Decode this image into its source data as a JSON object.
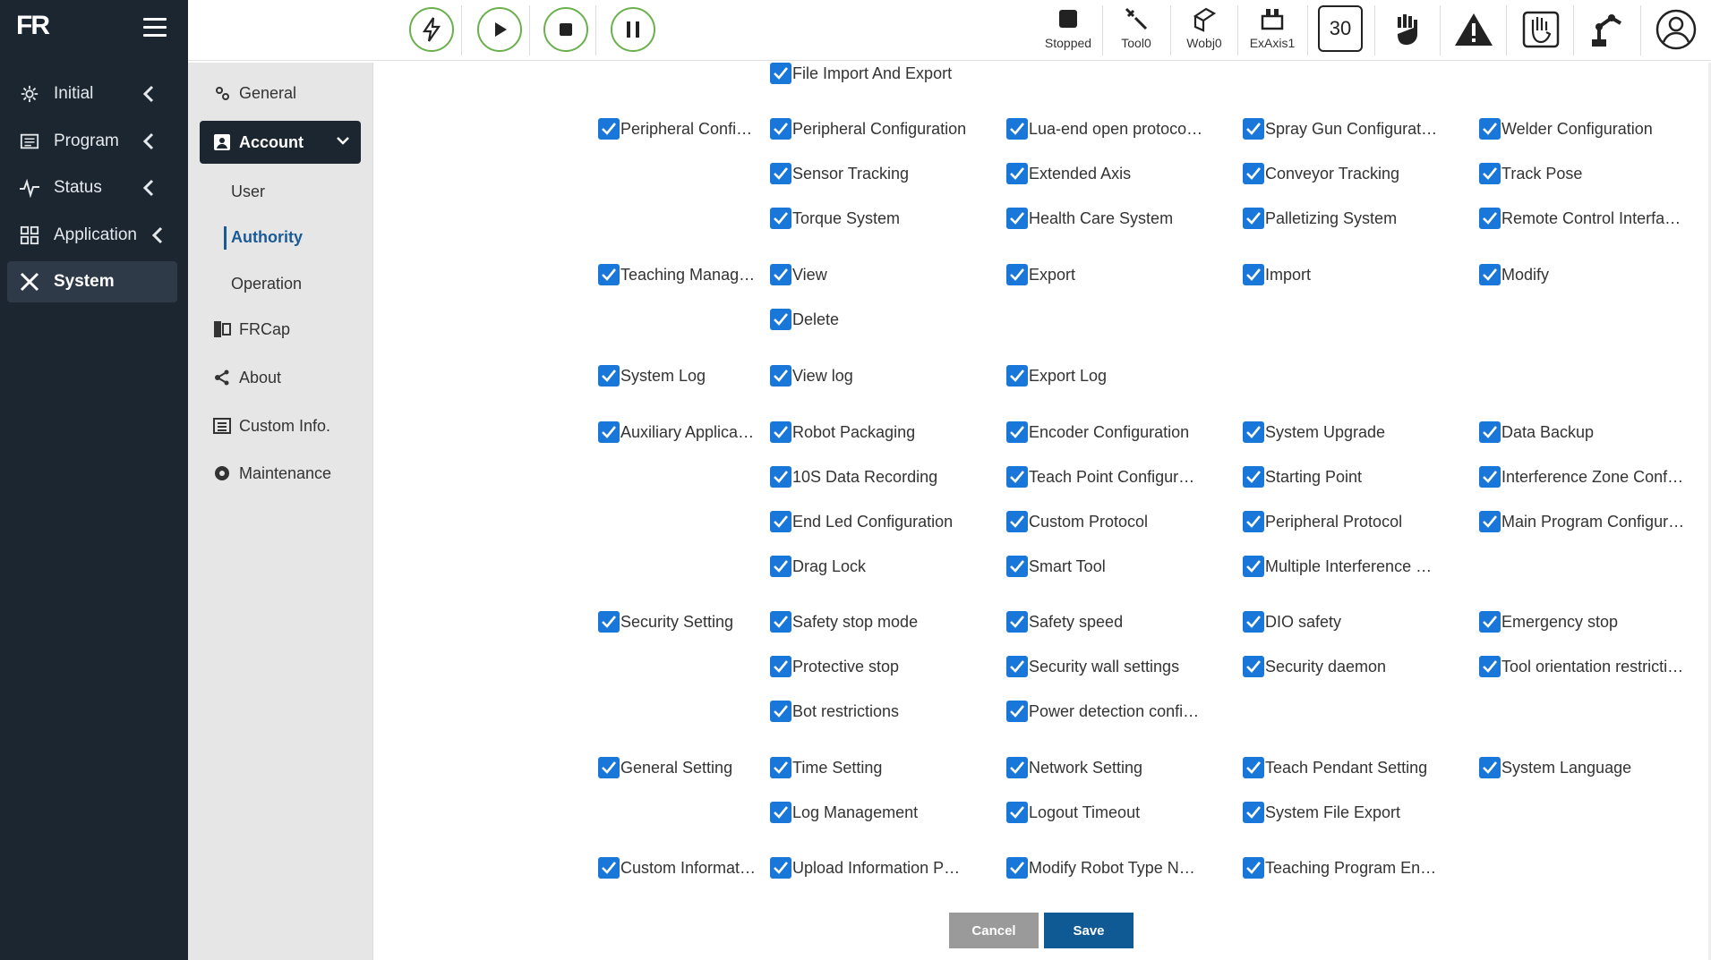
{
  "app": {
    "logo_text": "FR"
  },
  "main_nav": [
    {
      "label": "Initial",
      "icon": "gear-icon"
    },
    {
      "label": "Program",
      "icon": "program-icon"
    },
    {
      "label": "Status",
      "icon": "pulse-icon"
    },
    {
      "label": "Application",
      "icon": "grid-icon"
    },
    {
      "label": "System",
      "icon": "tools-icon",
      "active": true
    }
  ],
  "sub_nav": {
    "general": "General",
    "account": "Account",
    "account_children": [
      "User",
      "Authority",
      "Operation"
    ],
    "active_child": "Authority",
    "frcap": "FRCap",
    "about": "About",
    "custom_info": "Custom Info.",
    "maintenance": "Maintenance"
  },
  "toolbar": {
    "stopped": "Stopped",
    "tool": "Tool0",
    "wobj": "Wobj0",
    "exaxis": "ExAxis1",
    "speed": "30",
    "accent": "#6ab04c"
  },
  "permissions": {
    "rows": [
      {
        "group": "",
        "items": [
          "File Import And Export"
        ]
      },
      {
        "group": "Peripheral Confi…",
        "items": [
          "Peripheral Configuration",
          "Lua-end open protocol …",
          "Spray Gun Configuration",
          "Welder Configuration",
          "Sensor Tracking",
          "Extended Axis",
          "Conveyor Tracking",
          "Track Pose",
          "Torque System",
          "Health Care System",
          "Palletizing System",
          "Remote Control Interfa…"
        ]
      },
      {
        "group": "Teaching Manag…",
        "items": [
          "View",
          "Export",
          "Import",
          "Modify",
          "Delete"
        ]
      },
      {
        "group": "System Log",
        "items": [
          "View log",
          "Export Log"
        ]
      },
      {
        "group": "Auxiliary Applica…",
        "items": [
          "Robot Packaging",
          "Encoder Configuration",
          "System Upgrade",
          "Data Backup",
          "10S Data Recording",
          "Teach Point Configurati…",
          "Starting Point",
          "Interference Zone Conf…",
          "End Led Configuration",
          "Custom Protocol",
          "Peripheral Protocol",
          "Main Program Configur…",
          "Drag Lock",
          "Smart Tool",
          "Multiple Interference Z…"
        ]
      },
      {
        "group": "Security Setting",
        "items": [
          "Safety stop mode",
          "Safety speed",
          "DIO safety",
          "Emergency stop",
          "Protective stop",
          "Security wall settings",
          "Security daemon",
          "Tool orientation restricti…",
          "Bot restrictions",
          "Power detection config…"
        ]
      },
      {
        "group": "General Setting",
        "items": [
          "Time Setting",
          "Network Setting",
          "Teach Pendant Setting",
          "System Language",
          "Log Management",
          "Logout Timeout",
          "System File Export"
        ]
      },
      {
        "group": "Custom Informat…",
        "items": [
          "Upload Information Pa…",
          "Modify Robot Type Name",
          "Teaching Program Enc…"
        ]
      }
    ],
    "checked_color": "#1877d8"
  },
  "actions": {
    "cancel": "Cancel",
    "save": "Save"
  }
}
